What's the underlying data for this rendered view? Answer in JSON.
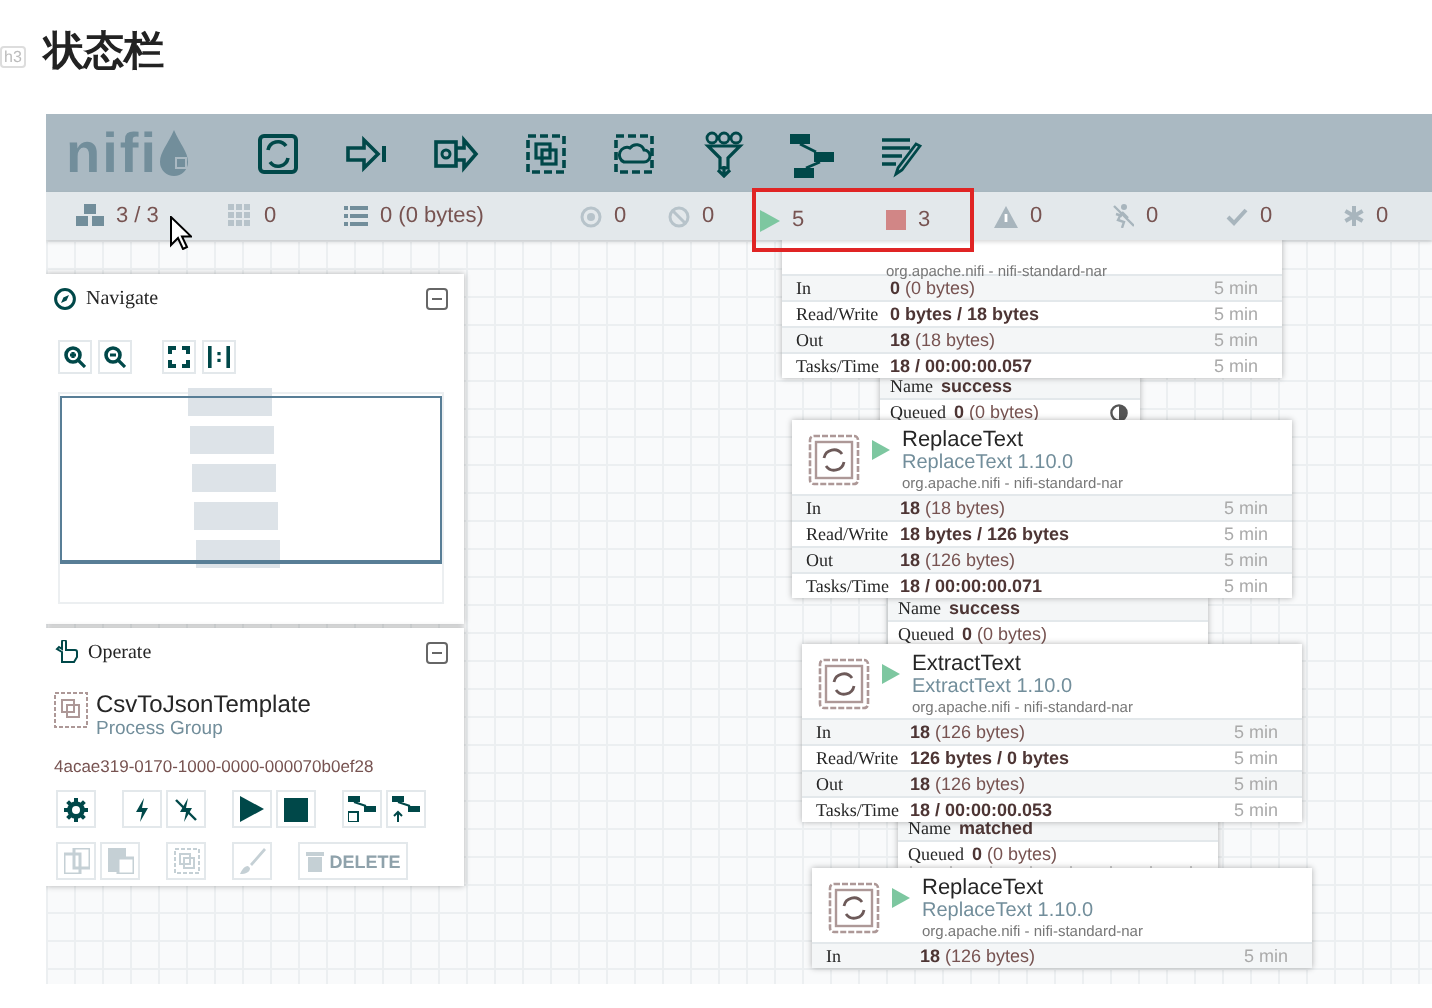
{
  "heading": {
    "marker": "h3",
    "title": "状态栏"
  },
  "toolbar": {
    "logo": "nifi"
  },
  "status_bar": [
    {
      "kind": "threads",
      "value": "3 / 3",
      "highlighted": false
    },
    {
      "kind": "tasks",
      "value": "0",
      "highlighted": false
    },
    {
      "kind": "queued",
      "value": "0 (0 bytes)",
      "highlighted": false
    },
    {
      "kind": "transmitting",
      "value": "0",
      "highlighted": false
    },
    {
      "kind": "not_transmitting",
      "value": "0",
      "highlighted": false
    },
    {
      "kind": "running",
      "value": "5",
      "highlighted": true
    },
    {
      "kind": "stopped",
      "value": "3",
      "highlighted": true
    },
    {
      "kind": "invalid",
      "value": "0",
      "highlighted": false
    },
    {
      "kind": "disabled",
      "value": "0",
      "highlighted": false
    },
    {
      "kind": "up_to_date",
      "value": "0",
      "highlighted": false
    },
    {
      "kind": "locally_modified",
      "value": "0",
      "highlighted": false
    }
  ],
  "navigate": {
    "title": "Navigate"
  },
  "operate": {
    "title": "Operate",
    "component": {
      "name": "CsvToJsonTemplate",
      "type": "Process Group",
      "id": "4acae319-0170-1000-0000-000070b0ef28"
    },
    "buttons": [
      {
        "kind": "configure",
        "disabled": false
      },
      {
        "kind": "enable",
        "disabled": false
      },
      {
        "kind": "disable",
        "disabled": false
      },
      {
        "kind": "start",
        "disabled": false
      },
      {
        "kind": "stop",
        "disabled": false
      },
      {
        "kind": "create_template",
        "disabled": false
      },
      {
        "kind": "upload_template",
        "disabled": false
      },
      {
        "kind": "copy",
        "disabled": true
      },
      {
        "kind": "paste",
        "disabled": true
      },
      {
        "kind": "group",
        "disabled": true
      },
      {
        "kind": "color",
        "disabled": true
      },
      {
        "kind": "delete",
        "disabled": true,
        "label": "DELETE"
      }
    ]
  },
  "processors": [
    {
      "bundle": "org.apache.nifi - nifi-standard-nar",
      "stats": [
        {
          "label": "In",
          "value": "**0** (0 bytes)",
          "time": "5 min"
        },
        {
          "label": "Read/Write",
          "value": "0 bytes / 18 bytes",
          "bold": true,
          "time": "5 min"
        },
        {
          "label": "Out",
          "value": "**18** (18 bytes)",
          "time": "5 min"
        },
        {
          "label": "Tasks/Time",
          "value": "18 / 00:00:00.057",
          "bold": true,
          "time": "5 min"
        }
      ]
    },
    {
      "name": "ReplaceText",
      "type": "ReplaceText 1.10.0",
      "bundle": "org.apache.nifi - nifi-standard-nar",
      "running": true,
      "stats": [
        {
          "label": "In",
          "value": "**18** (18 bytes)",
          "time": "5 min"
        },
        {
          "label": "Read/Write",
          "value": "18 bytes / 126 bytes",
          "bold": true,
          "time": "5 min"
        },
        {
          "label": "Out",
          "value": "**18** (126 bytes)",
          "time": "5 min"
        },
        {
          "label": "Tasks/Time",
          "value": "18 / 00:00:00.071",
          "bold": true,
          "time": "5 min"
        }
      ]
    },
    {
      "name": "ExtractText",
      "type": "ExtractText 1.10.0",
      "bundle": "org.apache.nifi - nifi-standard-nar",
      "running": true,
      "stats": [
        {
          "label": "In",
          "value": "**18** (126 bytes)",
          "time": "5 min"
        },
        {
          "label": "Read/Write",
          "value": "126 bytes / 0 bytes",
          "bold": true,
          "time": "5 min"
        },
        {
          "label": "Out",
          "value": "**18** (126 bytes)",
          "time": "5 min"
        },
        {
          "label": "Tasks/Time",
          "value": "18 / 00:00:00.053",
          "bold": true,
          "time": "5 min"
        }
      ]
    },
    {
      "name": "ReplaceText",
      "type": "ReplaceText 1.10.0",
      "bundle": "org.apache.nifi - nifi-standard-nar",
      "running": true,
      "stats": [
        {
          "label": "In",
          "value": "**18** (126 bytes)",
          "time": "5 min"
        }
      ]
    }
  ],
  "connections": [
    {
      "name_label": "Name",
      "name": "success",
      "queued_label": "Queued",
      "queued": "**0** (0 bytes)",
      "indicator": true
    },
    {
      "name_label": "Name",
      "name": "success",
      "queued_label": "Queued",
      "queued": "**0** (0 bytes)",
      "indicator": false
    },
    {
      "name_label": "Name",
      "name": "matched",
      "queued_label": "Queued",
      "queued": "**0** (0 bytes)",
      "indicator": false
    }
  ]
}
